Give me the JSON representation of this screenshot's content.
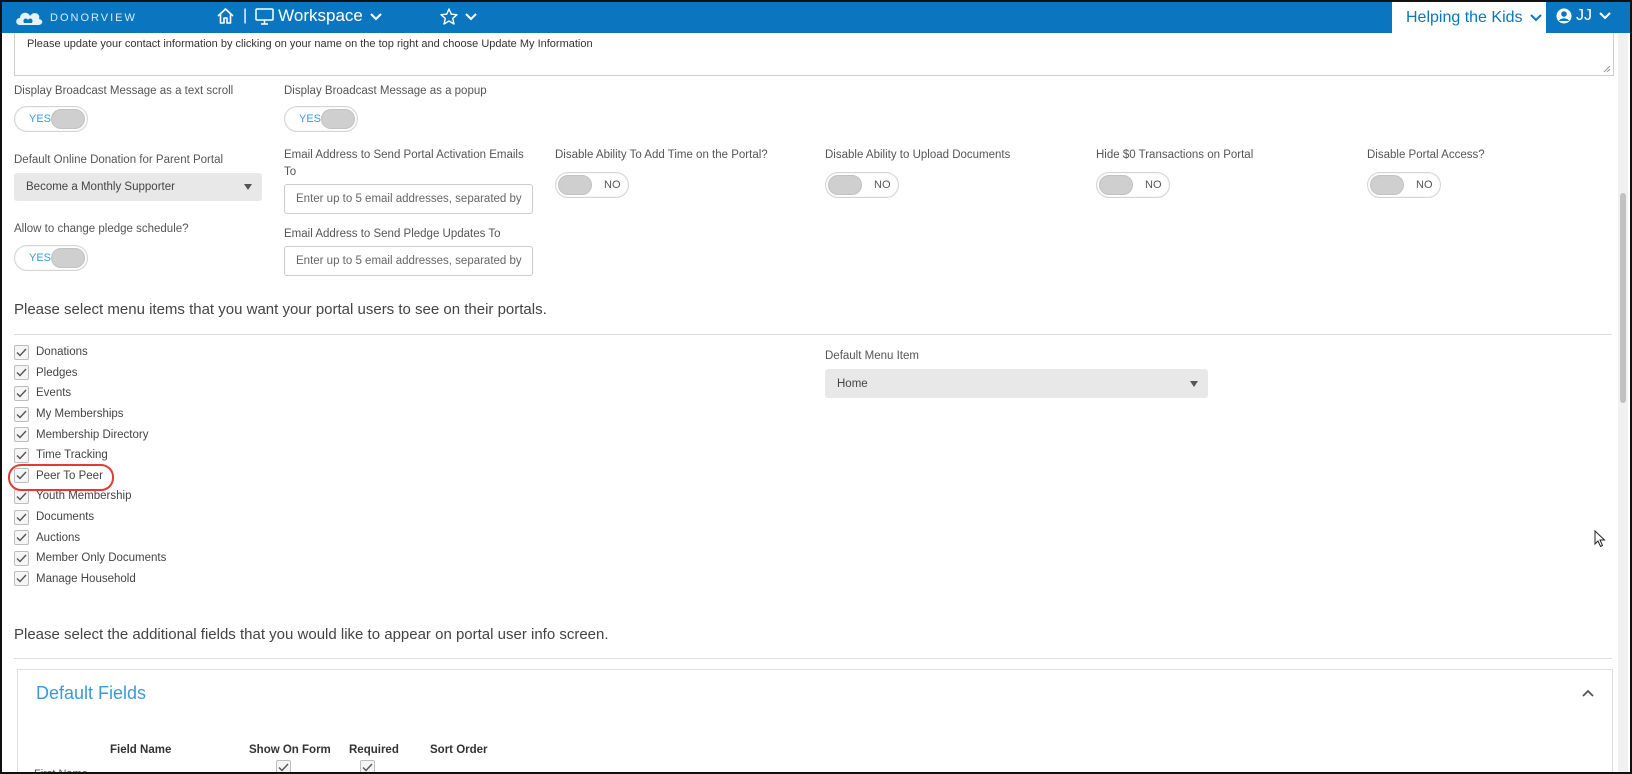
{
  "header": {
    "logo_text": "DONORVIEW",
    "workspace_label": "Workspace",
    "separator": "|",
    "org_name": "Helping the Kids",
    "user_initials": "JJ"
  },
  "broadcast": {
    "message": "Please update your contact information by clicking on your name on the top right and choose Update My Information"
  },
  "settings": {
    "text_scroll": {
      "label": "Display Broadcast Message as a text scroll",
      "value": "YES"
    },
    "popup": {
      "label": "Display Broadcast Message as a popup",
      "value": "YES"
    },
    "default_donation": {
      "label": "Default Online Donation for Parent Portal",
      "value": "Become a Monthly Supporter"
    },
    "activation_email": {
      "label_1": "Email Address to Send Portal Activation Emails",
      "label_2": "To",
      "placeholder": "Enter up to 5 email addresses, separated by"
    },
    "disable_add_time": {
      "label": "Disable Ability To Add Time on the Portal?",
      "value": "NO"
    },
    "disable_upload": {
      "label": "Disable Ability to Upload Documents",
      "value": "NO"
    },
    "hide_zero": {
      "label": "Hide $0 Transactions on Portal",
      "value": "NO"
    },
    "disable_access": {
      "label": "Disable Portal Access?",
      "value": "NO"
    },
    "pledge_schedule": {
      "label": "Allow to change pledge schedule?",
      "value": "YES"
    },
    "pledge_email": {
      "label": "Email Address to Send Pledge Updates To",
      "placeholder": "Enter up to 5 email addresses, separated by"
    }
  },
  "menu_section": {
    "heading": "Please select menu items that you want your portal users to see on their portals.",
    "items": [
      {
        "label": "Donations",
        "checked": true
      },
      {
        "label": "Pledges",
        "checked": true
      },
      {
        "label": "Events",
        "checked": true
      },
      {
        "label": "My Memberships",
        "checked": true
      },
      {
        "label": "Membership Directory",
        "checked": true
      },
      {
        "label": "Time Tracking",
        "checked": true
      },
      {
        "label": "Peer To Peer",
        "checked": true
      },
      {
        "label": "Youth Membership",
        "checked": true
      },
      {
        "label": "Documents",
        "checked": true
      },
      {
        "label": "Auctions",
        "checked": true
      },
      {
        "label": "Member Only Documents",
        "checked": true
      },
      {
        "label": "Manage Household",
        "checked": true
      }
    ],
    "default_menu_label": "Default Menu Item",
    "default_menu_value": "Home"
  },
  "fields_section": {
    "heading": "Please select the additional fields that you would like to appear on portal user info screen.",
    "panel_title": "Default Fields",
    "columns": [
      "Field Name",
      "Show On Form",
      "Required",
      "Sort Order"
    ],
    "first_row_label": "First Name"
  },
  "colors": {
    "brand_blue": "#0a76bf",
    "link_blue": "#3a9ad9",
    "highlight_red": "#e53935"
  }
}
